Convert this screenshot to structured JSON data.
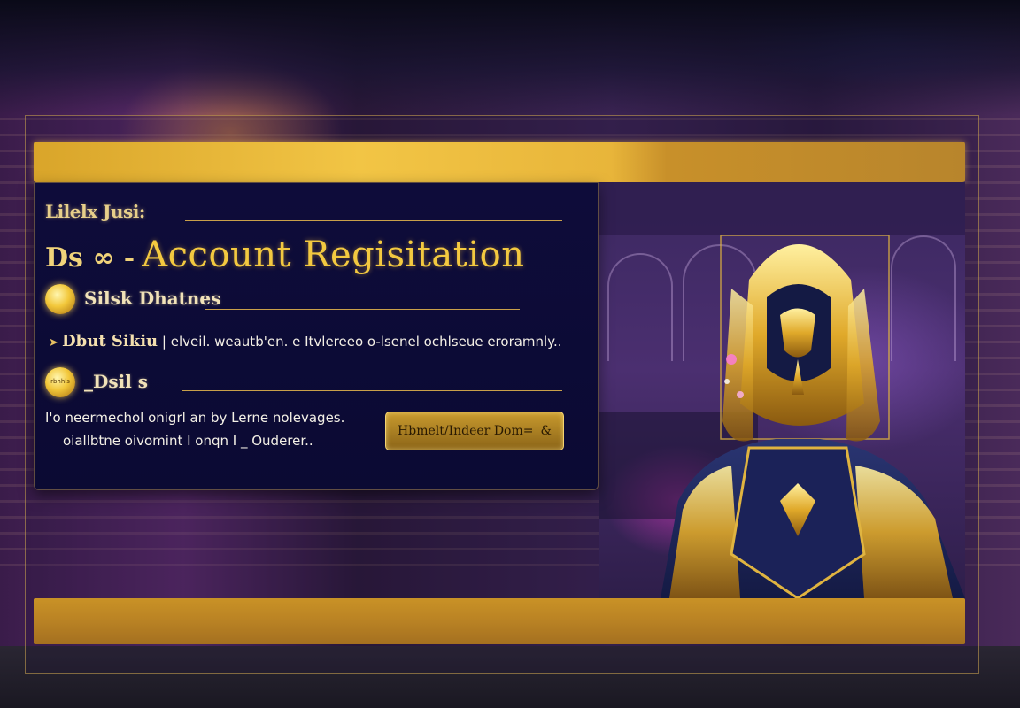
{
  "form": {
    "eyebrow": "Lilelx Jusi:",
    "title_prefix": "Ds ∞ -",
    "title": "Account Regisitation",
    "section1": {
      "orb_label": "",
      "label": "Silsk Dhatnes"
    },
    "row": {
      "label": "Dbut Sikiu",
      "text": "| elveil.   weautb'en. e Itvlereeo o-lsenel ochlseue eroramnly.."
    },
    "section2": {
      "orb_label": "rbhhls",
      "label": "_Dsil s"
    },
    "description": [
      "I'o neermechol onigrl  an by Lerne nolevages.",
      "oiallbtne oivomint  I onqn    I   _   Ouderer.."
    ],
    "cta": {
      "label": "Hbmelt/Indeer Dom=",
      "icon": "ampersand-icon"
    }
  },
  "colors": {
    "gold": "#f3c940",
    "panel": "#0e0c3a",
    "bar": "#e8b53a"
  }
}
